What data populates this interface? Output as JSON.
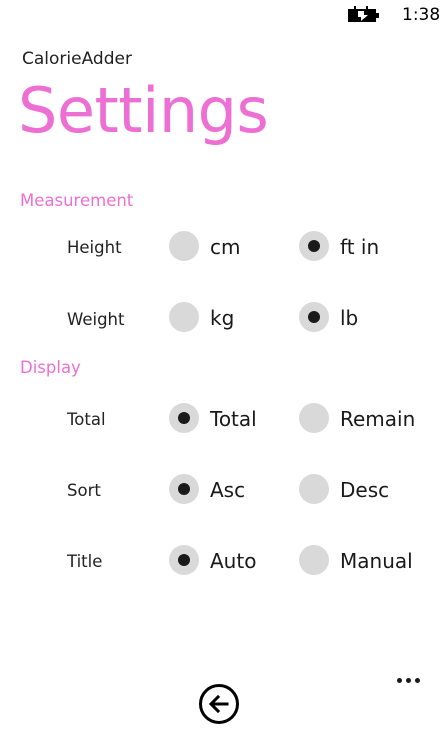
{
  "status_bar": {
    "time": "1:38",
    "battery_icon": "battery-charging-icon"
  },
  "header": {
    "app_name": "CalorieAdder",
    "page_title": "Settings"
  },
  "sections": {
    "measurement": {
      "title": "Measurement",
      "height": {
        "label": "Height",
        "options": [
          "cm",
          "ft in"
        ],
        "selected": "ft in"
      },
      "weight": {
        "label": "Weight",
        "options": [
          "kg",
          "lb"
        ],
        "selected": "lb"
      }
    },
    "display": {
      "title": "Display",
      "total": {
        "label": "Total",
        "options": [
          "Total",
          "Remain"
        ],
        "selected": "Total"
      },
      "sort": {
        "label": "Sort",
        "options": [
          "Asc",
          "Desc"
        ],
        "selected": "Asc"
      },
      "title_row": {
        "label": "Title",
        "options": [
          "Auto",
          "Manual"
        ],
        "selected": "Auto"
      }
    }
  },
  "app_bar": {
    "back_icon": "back-arrow-icon",
    "more_icon": "ellipsis-icon"
  }
}
